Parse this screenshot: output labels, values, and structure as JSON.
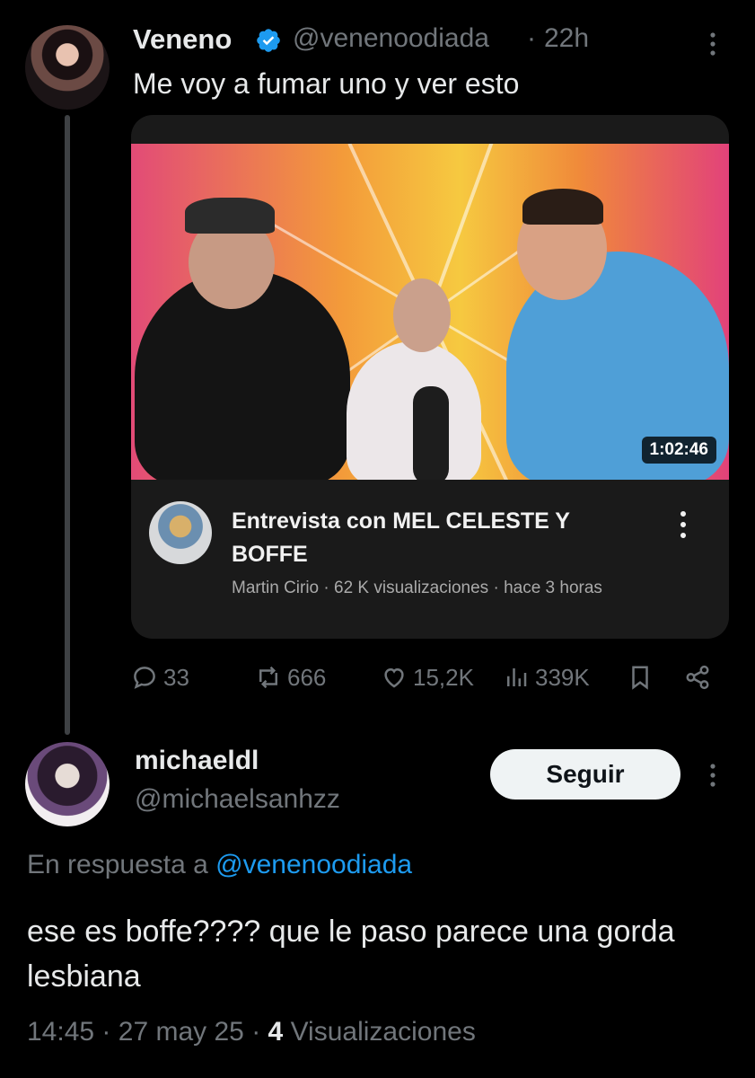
{
  "tweet": {
    "author_name": "Veneno",
    "author_handle": "@venenoodiada",
    "separator": "·",
    "time": "22h",
    "text": "Me voy a fumar uno y ver esto",
    "video": {
      "duration": "1:02:46",
      "title": "Entrevista con MEL CELESTE Y BOFFE",
      "channel": "Martin Cirio",
      "meta_sep": " · ",
      "views": "62 K visualizaciones",
      "age": "hace 3 horas"
    },
    "actions": {
      "replies": "33",
      "reposts": "666",
      "likes": "15,2K",
      "views": "339K"
    }
  },
  "reply": {
    "author_name": "michaeldl",
    "author_handle": "@michaelsanhzz",
    "follow_label": "Seguir",
    "reply_prefix": "En respuesta a",
    "reply_mention": "@venenoodiada",
    "text": "ese es boffe???? que le paso parece una gorda lesbiana",
    "time": "14:45",
    "date": "27 may 25",
    "separator": "·",
    "views_count": "4",
    "views_label": "Visualizaciones"
  },
  "colors": {
    "background": "#000000",
    "text": "#e7e9ea",
    "secondary": "#71767b",
    "accent": "#1d9bf0"
  }
}
